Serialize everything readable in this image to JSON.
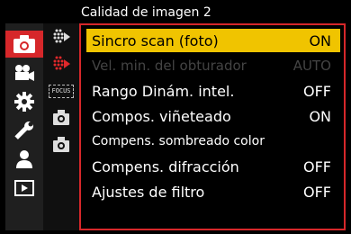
{
  "header": {
    "title": "Calidad de imagen 2"
  },
  "main_tabs": [
    {
      "icon": "camera-icon",
      "active": true
    },
    {
      "icon": "movie-camera-icon",
      "active": false
    },
    {
      "icon": "gear-icon",
      "active": false
    },
    {
      "icon": "wrench-icon",
      "active": false
    },
    {
      "icon": "person-icon",
      "active": false
    },
    {
      "icon": "playback-icon",
      "active": false
    }
  ],
  "sub_tabs": [
    {
      "icon": "image-quality-1-icon"
    },
    {
      "icon": "image-quality-2-icon",
      "active": true
    },
    {
      "icon": "focus-icon",
      "label": "FOCUS"
    },
    {
      "icon": "camera-settings-1-icon"
    },
    {
      "icon": "camera-settings-2-icon"
    }
  ],
  "menu": {
    "items": [
      {
        "label": "Sincro scan (foto)",
        "value": "ON",
        "state": "selected"
      },
      {
        "label": "Vel. min. del obturador",
        "value": "AUTO",
        "state": "disabled"
      },
      {
        "label": "Rango Dinám. intel.",
        "value": "OFF",
        "state": "normal"
      },
      {
        "label": "Compos. viñeteado",
        "value": "ON",
        "state": "normal"
      },
      {
        "label": "Compens. sombreado color",
        "value": "",
        "state": "normal"
      },
      {
        "label": "Compens. difracción",
        "value": "OFF",
        "state": "normal"
      },
      {
        "label": "Ajustes de filtro",
        "value": "OFF",
        "state": "normal"
      }
    ]
  },
  "colors": {
    "accent": "#d6272a",
    "selection": "#f0c400",
    "disabled": "#444444"
  }
}
